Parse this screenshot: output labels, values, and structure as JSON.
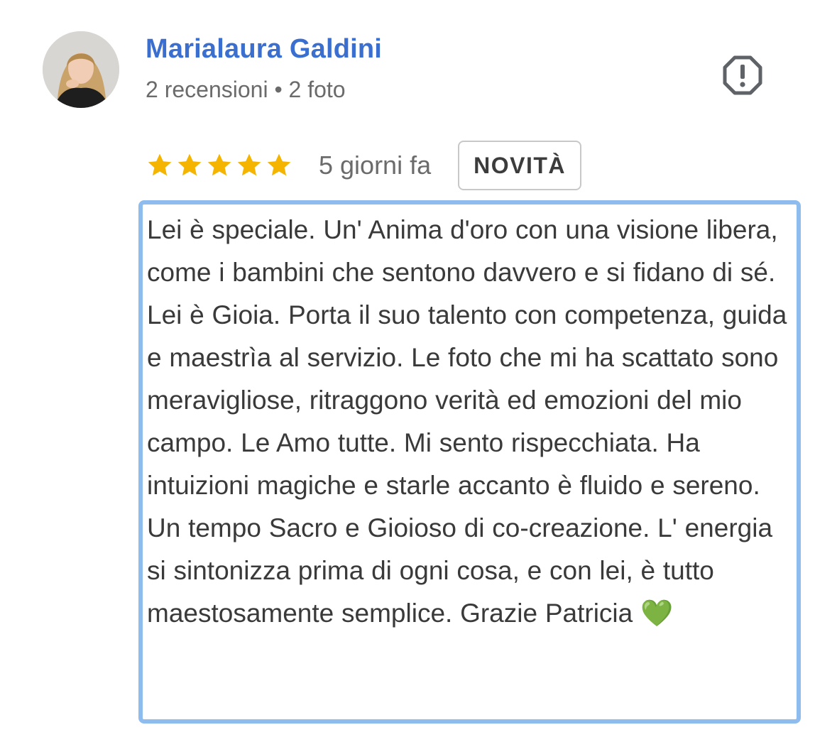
{
  "reviewer": {
    "name": "Marialaura Galdini",
    "meta": "2 recensioni • 2 foto",
    "avatar_icon": "profile-photo"
  },
  "flag_icon": "report-octagon-icon",
  "rating": {
    "stars": 5,
    "max_stars": 5,
    "star_color": "#F4B400",
    "date": "5 giorni fa",
    "badge": "NOVITÀ"
  },
  "review": {
    "text": "Lei è speciale. Un' Anima d'oro con una visione libera, come i bambini che sentono davvero e si fidano di sé. Lei è Gioia. Porta il suo talento con competenza, guida e maestrìa al servizio. Le foto che mi ha scattato sono meravigliose, ritraggono verità ed emozioni del mio campo. Le Amo tutte. Mi sento rispecchiata. Ha intuizioni magiche e starle accanto è fluido e sereno. Un tempo Sacro e Gioioso di co-creazione. L' energia si sintonizza prima di ogni cosa, e con lei, è tutto maestosamente semplice. Grazie Patricia",
    "emoji": "💚",
    "border_color": "#8FBCEF"
  },
  "colors": {
    "name": "#3A6FD0",
    "meta": "#6B6B6B",
    "text": "#3A3A3A"
  }
}
